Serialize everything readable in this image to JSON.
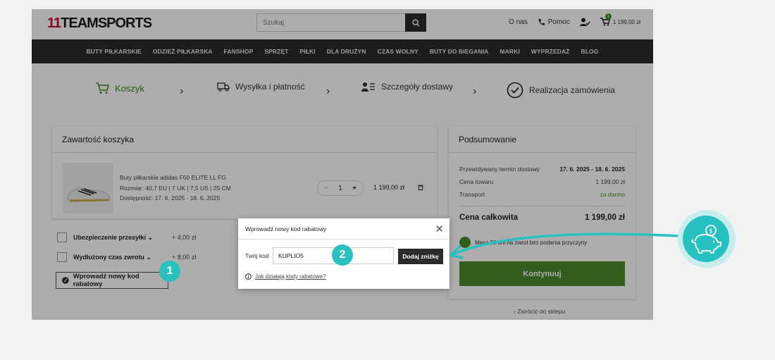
{
  "header": {
    "logo_num": "11",
    "logo_text": "TEAMSPORTS",
    "search_placeholder": "Szukaj",
    "about": "O nas",
    "help": "Pomoc",
    "cart_count": "1",
    "cart_total": "1 199,00 zł"
  },
  "nav": [
    "BUTY PIŁKARSKIE",
    "ODZIEŻ PIŁKARSKA",
    "FANSHOP",
    "SPRZĘT",
    "PIŁKI",
    "DLA DRUŻYN",
    "CZAS WOLNY",
    "BUTY DO BIEGANIA",
    "MARKI",
    "WYPRZEDAŻ",
    "BLOG"
  ],
  "steps": {
    "cart": "Koszyk",
    "shipping": "Wysyłka i płatność",
    "details": "Szczegóły dostawy",
    "confirm": "Realizacja zamówienia"
  },
  "cart": {
    "title": "Zawartość koszyka",
    "item_name": "Buty piłkarskie adidas F50 ELITE LL FG",
    "item_size": "Rozmiar: 40,7 EU | 7 UK | 7,5 US | 25 CM",
    "item_availability": "Dostępność:  17. 6. 2025 - 18. 6. 2025",
    "qty": "1",
    "price": "1 199,00 zł",
    "options": [
      {
        "label": "Ubezpieczenie przesyłki",
        "price": "+ 4,00 zł"
      },
      {
        "label": "Wydłużony czas zwrotu",
        "price": "+ 8,00 zł"
      }
    ],
    "promo_button": "Wprowadź nowy kod rabatowy"
  },
  "summary": {
    "title": "Podsumowanie",
    "rows": [
      {
        "label": "Przewidywany termin dostawy",
        "value": "17. 6. 2025 - 18. 6. 2025"
      },
      {
        "label": "Cena towaru",
        "value": "1 199,00 zł"
      },
      {
        "label": "Transport",
        "value": "za darmo"
      }
    ],
    "total_label": "Cena całkowita",
    "total_value": "1 199,00 zł",
    "return_note": "Masz 30 dni na zwrot bez podania przyczyny",
    "continue": "Kontynuuj",
    "back": "Zwrócić do sklepu"
  },
  "modal": {
    "title": "Wprowadź nowy kod rabatowy",
    "code_label": "Twój kod",
    "code_value": "KUPLIO5",
    "apply": "Dodaj zniżkę",
    "help": "Jak działają kody rabatowe?"
  },
  "annotations": {
    "step1": "1",
    "step2": "2"
  },
  "colors": {
    "green": "#4a8a2c",
    "teal": "#27c1c1",
    "dark": "#2b2b2b"
  }
}
